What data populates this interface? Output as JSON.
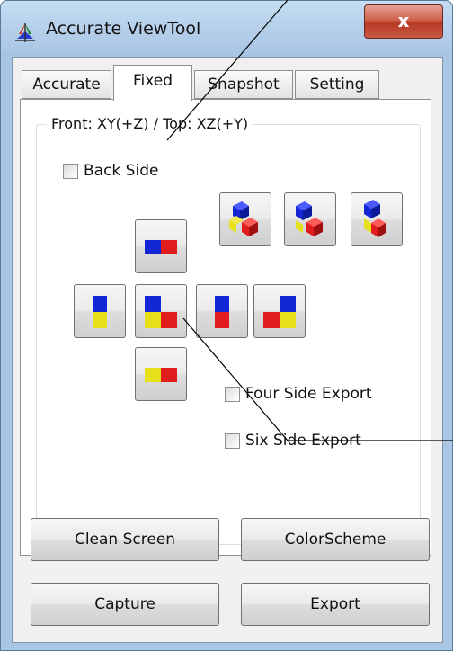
{
  "window": {
    "title": "Accurate ViewTool",
    "close_label": "x"
  },
  "tabs": [
    {
      "label": "Accurate",
      "active": false
    },
    {
      "label": "Fixed",
      "active": true
    },
    {
      "label": "Snapshot",
      "active": false
    },
    {
      "label": "Setting",
      "active": false
    }
  ],
  "group": {
    "legend": "Front: XY(+Z) / Top: XZ(+Y)"
  },
  "options": {
    "back_side": {
      "label": "Back Side",
      "checked": false
    },
    "four_side_export": {
      "label": "Four Side Export",
      "checked": false
    },
    "six_side_export": {
      "label": "Six Side Export",
      "checked": false
    }
  },
  "buttons": {
    "clean_screen": "Clean Screen",
    "color_scheme": "ColorScheme",
    "capture": "Capture",
    "export": "Export"
  },
  "colors": {
    "red": "#e01c1c",
    "blue": "#1226d6",
    "yellow": "#e6e01a",
    "accent": "#cc3b26"
  }
}
